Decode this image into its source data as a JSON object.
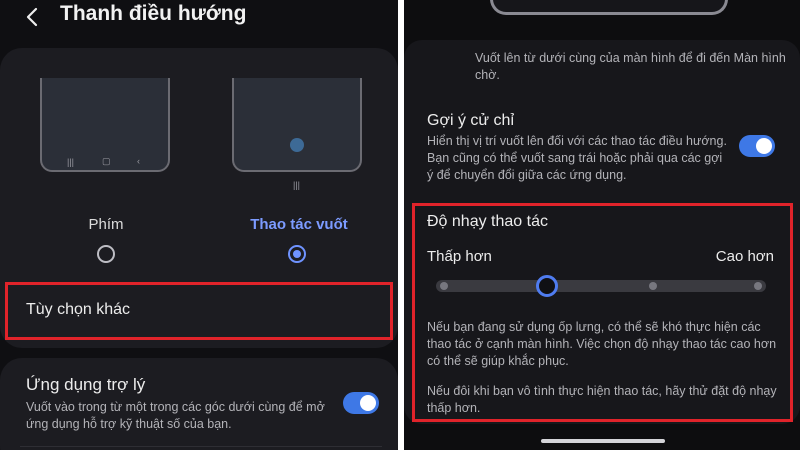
{
  "colors": {
    "accent": "#6f93ff",
    "highlight": "#e0232a",
    "toggle_on": "#3e78e6",
    "background": "#0f0f12",
    "card": "#1c1c21"
  },
  "left": {
    "header": {
      "title": "Thanh điều hướng",
      "back_icon": "chevron-left-icon"
    },
    "nav_options": [
      {
        "label": "Phím",
        "selected": false
      },
      {
        "label": "Thao tác vuốt",
        "selected": true
      }
    ],
    "more_options": {
      "label": "Tùy chọn khác"
    },
    "assistant": {
      "title": "Ứng dụng trợ lý",
      "desc_line1": "Vuốt vào trong từ một trong các góc dưới cùng để mở",
      "desc_line2": "ứng dụng hỗ trợ kỹ thuật số của bạn.",
      "enabled": true
    }
  },
  "right": {
    "swipe_hint_line1": "Vuốt lên từ dưới cùng của màn hình để đi đến Màn hình",
    "swipe_hint_line2": "chờ.",
    "gesture_hint": {
      "title": "Gợi ý cử chỉ",
      "desc_line1": "Hiển thị vị trí vuốt lên đối với các thao tác điều hướng.",
      "desc_line2": "Bạn cũng có thể vuốt sang trái hoặc phải qua các gợi",
      "desc_line3": "ý để chuyển đổi giữa các ứng dụng.",
      "enabled": true
    },
    "sensitivity": {
      "title": "Độ nhạy thao tác",
      "low_label": "Thấp hơn",
      "high_label": "Cao hơn",
      "level": 2,
      "levels": 5,
      "note1_line1": "Nếu bạn đang sử dụng ốp lưng, có thể sẽ khó thực hiện các",
      "note1_line2": "thao tác ở cạnh màn hình. Việc chọn độ nhạy thao tác cao hơn",
      "note1_line3": "có thể sẽ giúp khắc phục.",
      "note2_line1": "Nếu đôi khi bạn vô tình thực hiện thao tác, hãy thử đặt độ nhạy",
      "note2_line2": "thấp hơn."
    }
  }
}
